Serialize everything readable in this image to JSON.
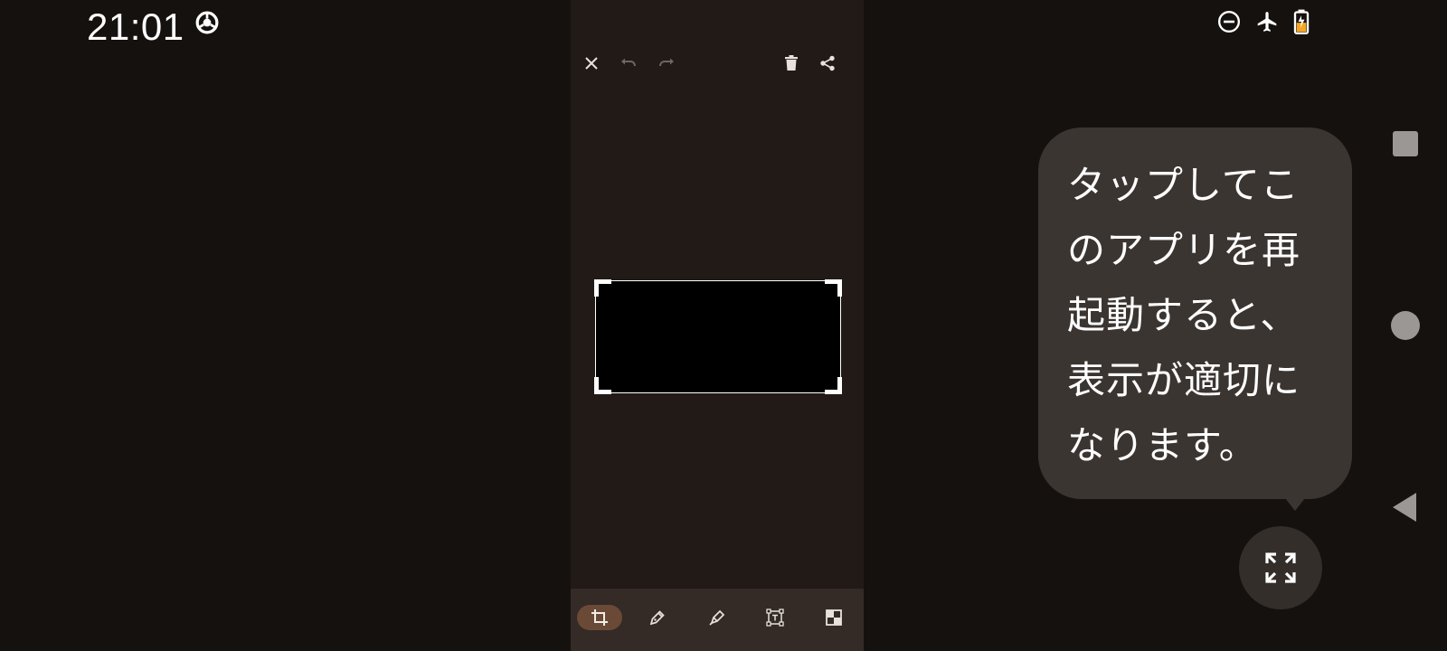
{
  "status_bar": {
    "time": "21:01",
    "left_icons": [
      "chrome-icon"
    ],
    "right_icons": [
      "do-not-disturb-icon",
      "airplane-mode-icon",
      "battery-charging-icon"
    ]
  },
  "editor": {
    "top_toolbar": [
      "close-icon",
      "undo-icon",
      "redo-icon",
      "delete-icon",
      "share-icon"
    ],
    "bottom_tools": [
      "crop-icon",
      "pen-icon",
      "highlighter-icon",
      "text-box-icon",
      "pixelate-icon"
    ],
    "active_tool": "crop-icon"
  },
  "restart_hint": {
    "message": "タップしてこのアプリを再起動すると、表示が適切になります。"
  },
  "nav_bar": [
    "recents-button",
    "home-button",
    "back-button"
  ],
  "colors": {
    "background": "#15110e",
    "app_panel": "#221a17",
    "bottom_bar": "#342a26",
    "active_tool": "#6a4a37",
    "bubble": "#3b3532"
  }
}
